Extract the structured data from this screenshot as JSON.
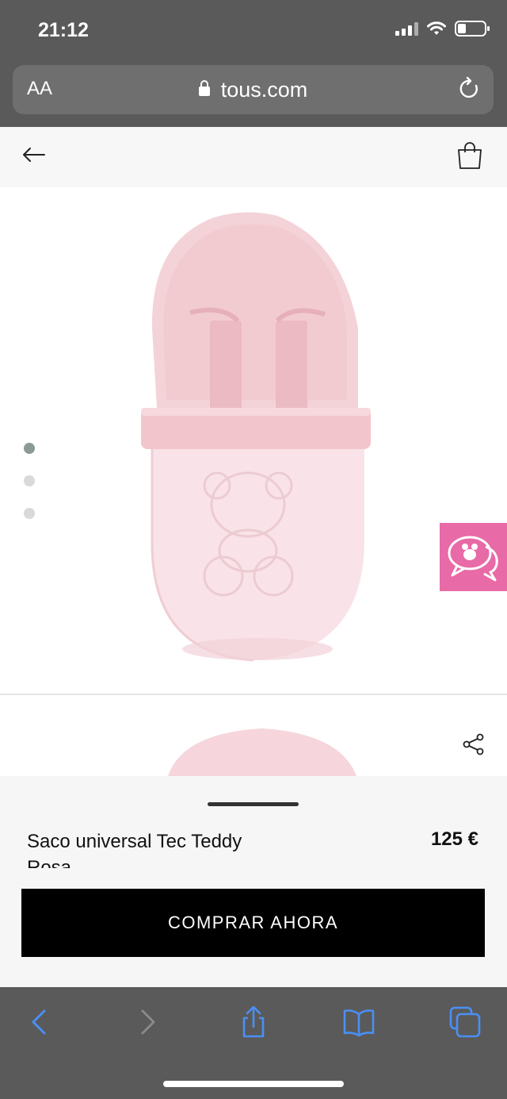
{
  "status_bar": {
    "time": "21:12"
  },
  "browser": {
    "text_size_label": "AA",
    "url": "tous.com"
  },
  "icons": {
    "back": "arrow-left-icon",
    "bag": "shopping-bag-icon",
    "share": "share-icon",
    "chat": "chat-bubbles-icon",
    "reload": "reload-icon"
  },
  "gallery": {
    "total_images": 3,
    "active_index": 0
  },
  "product": {
    "name": "Saco universal Tec Teddy Rosa",
    "price": "125 €",
    "buy_label": "COMPRAR AHORA"
  },
  "colors": {
    "chat_badge": "#e86aa6",
    "button": "#000000",
    "product_pink": "#f3cfd5",
    "safari_blue": "#4a8ff5"
  }
}
